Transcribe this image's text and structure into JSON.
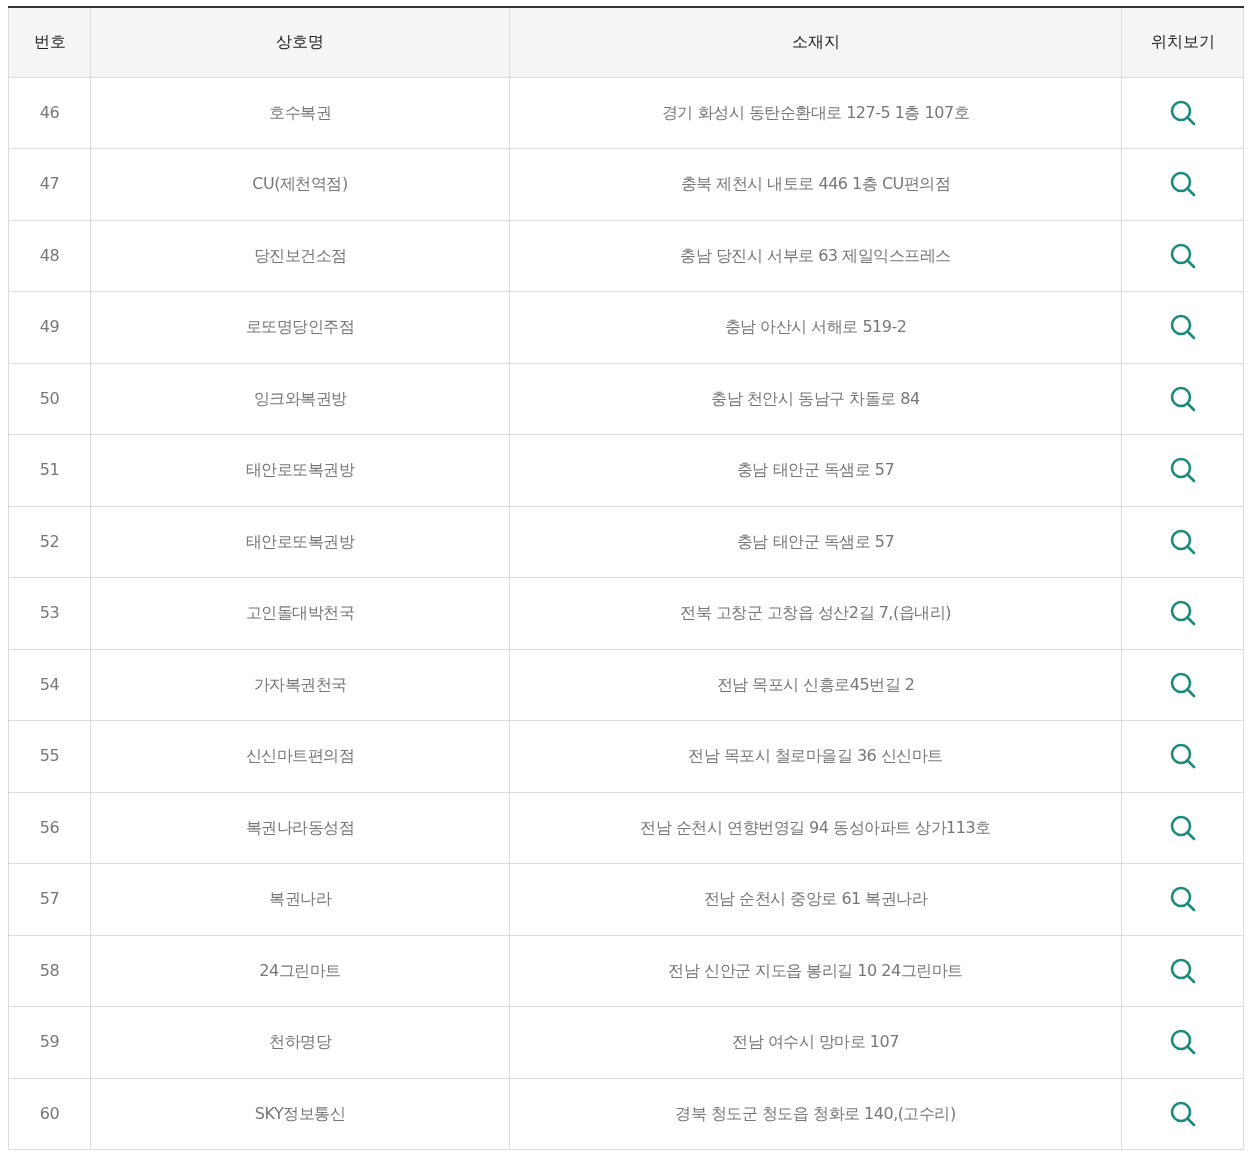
{
  "table": {
    "columns": [
      "번호",
      "상호명",
      "소재지",
      "위치보기"
    ],
    "rows": [
      {
        "number": "46",
        "name": "호수복권",
        "address": "경기 화성시 동탄순환대로 127-5 1층 107호"
      },
      {
        "number": "47",
        "name": "CU(제천역점)",
        "address": "충북 제천시 내토로 446 1층 CU편의점"
      },
      {
        "number": "48",
        "name": "당진보건소점",
        "address": "충남 당진시 서부로 63 제일익스프레스"
      },
      {
        "number": "49",
        "name": "로또명당인주점",
        "address": "충남 아산시 서해로 519-2"
      },
      {
        "number": "50",
        "name": "잉크와복권방",
        "address": "충남 천안시 동남구 차돌로 84"
      },
      {
        "number": "51",
        "name": "태안로또복권방",
        "address": "충남 태안군 독샘로 57"
      },
      {
        "number": "52",
        "name": "태안로또복권방",
        "address": "충남 태안군 독샘로 57"
      },
      {
        "number": "53",
        "name": "고인돌대박천국",
        "address": "전북 고창군 고창읍 성산2길 7,(읍내리)"
      },
      {
        "number": "54",
        "name": "가자복권천국",
        "address": "전남 목포시 신흥로45번길 2"
      },
      {
        "number": "55",
        "name": "신신마트편의점",
        "address": "전남 목포시 철로마을길 36 신신마트"
      },
      {
        "number": "56",
        "name": "복권나라동성점",
        "address": "전남 순천시 연향번영길 94 동성아파트 상가113호"
      },
      {
        "number": "57",
        "name": "복권나라",
        "address": "전남 순천시 중앙로 61 복권나라"
      },
      {
        "number": "58",
        "name": "24그린마트",
        "address": "전남 신안군 지도읍 봉리길 10 24그린마트"
      },
      {
        "number": "59",
        "name": "천하명당",
        "address": "전남 여수시 망마로 107"
      },
      {
        "number": "60",
        "name": "SKY정보통신",
        "address": "경북 청도군 청도읍 청화로 140,(고수리)"
      }
    ]
  }
}
